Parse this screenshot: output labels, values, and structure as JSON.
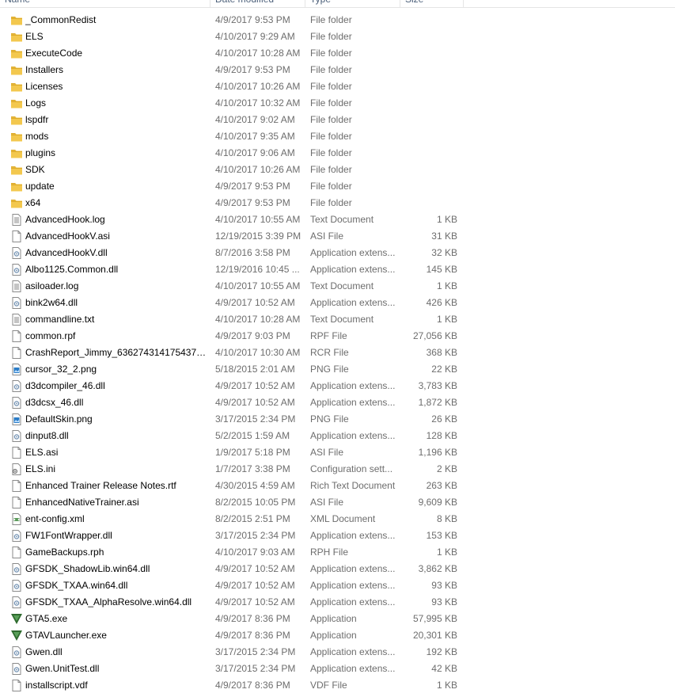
{
  "columns": {
    "name": "Name",
    "date": "Date modified",
    "type": "Type",
    "size": "Size"
  },
  "colors": {
    "folder": "#f3c84e",
    "folder_dark": "#dcaa2a",
    "gta": "#2f6b2f"
  },
  "files": [
    {
      "name": "_CommonRedist",
      "date": "4/9/2017 9:53 PM",
      "type": "File folder",
      "size": "",
      "icon": "folder-icon"
    },
    {
      "name": "ELS",
      "date": "4/10/2017 9:29 AM",
      "type": "File folder",
      "size": "",
      "icon": "folder-icon"
    },
    {
      "name": "ExecuteCode",
      "date": "4/10/2017 10:28 AM",
      "type": "File folder",
      "size": "",
      "icon": "folder-icon"
    },
    {
      "name": "Installers",
      "date": "4/9/2017 9:53 PM",
      "type": "File folder",
      "size": "",
      "icon": "folder-icon"
    },
    {
      "name": "Licenses",
      "date": "4/10/2017 10:26 AM",
      "type": "File folder",
      "size": "",
      "icon": "folder-icon"
    },
    {
      "name": "Logs",
      "date": "4/10/2017 10:32 AM",
      "type": "File folder",
      "size": "",
      "icon": "folder-icon"
    },
    {
      "name": "lspdfr",
      "date": "4/10/2017 9:02 AM",
      "type": "File folder",
      "size": "",
      "icon": "folder-icon"
    },
    {
      "name": "mods",
      "date": "4/10/2017 9:35 AM",
      "type": "File folder",
      "size": "",
      "icon": "folder-icon"
    },
    {
      "name": "plugins",
      "date": "4/10/2017 9:06 AM",
      "type": "File folder",
      "size": "",
      "icon": "folder-icon"
    },
    {
      "name": "SDK",
      "date": "4/10/2017 10:26 AM",
      "type": "File folder",
      "size": "",
      "icon": "folder-icon"
    },
    {
      "name": "update",
      "date": "4/9/2017 9:53 PM",
      "type": "File folder",
      "size": "",
      "icon": "folder-icon"
    },
    {
      "name": "x64",
      "date": "4/9/2017 9:53 PM",
      "type": "File folder",
      "size": "",
      "icon": "folder-icon"
    },
    {
      "name": "AdvancedHook.log",
      "date": "4/10/2017 10:55 AM",
      "type": "Text Document",
      "size": "1 KB",
      "icon": "text-file-icon"
    },
    {
      "name": "AdvancedHookV.asi",
      "date": "12/19/2015 3:39 PM",
      "type": "ASI File",
      "size": "31 KB",
      "icon": "blank-file-icon"
    },
    {
      "name": "AdvancedHookV.dll",
      "date": "8/7/2016 3:58 PM",
      "type": "Application extens...",
      "size": "32 KB",
      "icon": "dll-file-icon"
    },
    {
      "name": "Albo1125.Common.dll",
      "date": "12/19/2016 10:45 ...",
      "type": "Application extens...",
      "size": "145 KB",
      "icon": "dll-file-icon"
    },
    {
      "name": "asiloader.log",
      "date": "4/10/2017 10:55 AM",
      "type": "Text Document",
      "size": "1 KB",
      "icon": "text-file-icon"
    },
    {
      "name": "bink2w64.dll",
      "date": "4/9/2017 10:52 AM",
      "type": "Application extens...",
      "size": "426 KB",
      "icon": "dll-file-icon"
    },
    {
      "name": "commandline.txt",
      "date": "4/10/2017 10:28 AM",
      "type": "Text Document",
      "size": "1 KB",
      "icon": "text-file-icon"
    },
    {
      "name": "common.rpf",
      "date": "4/9/2017 9:03 PM",
      "type": "RPF File",
      "size": "27,056 KB",
      "icon": "blank-file-icon"
    },
    {
      "name": "CrashReport_Jimmy_63627431417543706...",
      "date": "4/10/2017 10:30 AM",
      "type": "RCR File",
      "size": "368 KB",
      "icon": "blank-file-icon"
    },
    {
      "name": "cursor_32_2.png",
      "date": "5/18/2015 2:01 AM",
      "type": "PNG File",
      "size": "22 KB",
      "icon": "image-file-icon"
    },
    {
      "name": "d3dcompiler_46.dll",
      "date": "4/9/2017 10:52 AM",
      "type": "Application extens...",
      "size": "3,783 KB",
      "icon": "dll-file-icon"
    },
    {
      "name": "d3dcsx_46.dll",
      "date": "4/9/2017 10:52 AM",
      "type": "Application extens...",
      "size": "1,872 KB",
      "icon": "dll-file-icon"
    },
    {
      "name": "DefaultSkin.png",
      "date": "3/17/2015 2:34 PM",
      "type": "PNG File",
      "size": "26 KB",
      "icon": "image-file-icon"
    },
    {
      "name": "dinput8.dll",
      "date": "5/2/2015 1:59 AM",
      "type": "Application extens...",
      "size": "128 KB",
      "icon": "dll-file-icon"
    },
    {
      "name": "ELS.asi",
      "date": "1/9/2017 5:18 PM",
      "type": "ASI File",
      "size": "1,196 KB",
      "icon": "blank-file-icon"
    },
    {
      "name": "ELS.ini",
      "date": "1/7/2017 3:38 PM",
      "type": "Configuration sett...",
      "size": "2 KB",
      "icon": "config-file-icon"
    },
    {
      "name": "Enhanced Trainer Release Notes.rtf",
      "date": "4/30/2015 4:59 AM",
      "type": "Rich Text Document",
      "size": "263 KB",
      "icon": "blank-file-icon"
    },
    {
      "name": "EnhancedNativeTrainer.asi",
      "date": "8/2/2015 10:05 PM",
      "type": "ASI File",
      "size": "9,609 KB",
      "icon": "blank-file-icon"
    },
    {
      "name": "ent-config.xml",
      "date": "8/2/2015 2:51 PM",
      "type": "XML Document",
      "size": "8 KB",
      "icon": "xml-file-icon"
    },
    {
      "name": "FW1FontWrapper.dll",
      "date": "3/17/2015 2:34 PM",
      "type": "Application extens...",
      "size": "153 KB",
      "icon": "dll-file-icon"
    },
    {
      "name": "GameBackups.rph",
      "date": "4/10/2017 9:03 AM",
      "type": "RPH File",
      "size": "1 KB",
      "icon": "blank-file-icon"
    },
    {
      "name": "GFSDK_ShadowLib.win64.dll",
      "date": "4/9/2017 10:52 AM",
      "type": "Application extens...",
      "size": "3,862 KB",
      "icon": "dll-file-icon"
    },
    {
      "name": "GFSDK_TXAA.win64.dll",
      "date": "4/9/2017 10:52 AM",
      "type": "Application extens...",
      "size": "93 KB",
      "icon": "dll-file-icon"
    },
    {
      "name": "GFSDK_TXAA_AlphaResolve.win64.dll",
      "date": "4/9/2017 10:52 AM",
      "type": "Application extens...",
      "size": "93 KB",
      "icon": "dll-file-icon"
    },
    {
      "name": "GTA5.exe",
      "date": "4/9/2017 8:36 PM",
      "type": "Application",
      "size": "57,995 KB",
      "icon": "gta-app-icon"
    },
    {
      "name": "GTAVLauncher.exe",
      "date": "4/9/2017 8:36 PM",
      "type": "Application",
      "size": "20,301 KB",
      "icon": "gta-app-icon"
    },
    {
      "name": "Gwen.dll",
      "date": "3/17/2015 2:34 PM",
      "type": "Application extens...",
      "size": "192 KB",
      "icon": "dll-file-icon"
    },
    {
      "name": "Gwen.UnitTest.dll",
      "date": "3/17/2015 2:34 PM",
      "type": "Application extens...",
      "size": "42 KB",
      "icon": "dll-file-icon"
    },
    {
      "name": "installscript.vdf",
      "date": "4/9/2017 8:36 PM",
      "type": "VDF File",
      "size": "1 KB",
      "icon": "blank-file-icon"
    }
  ]
}
